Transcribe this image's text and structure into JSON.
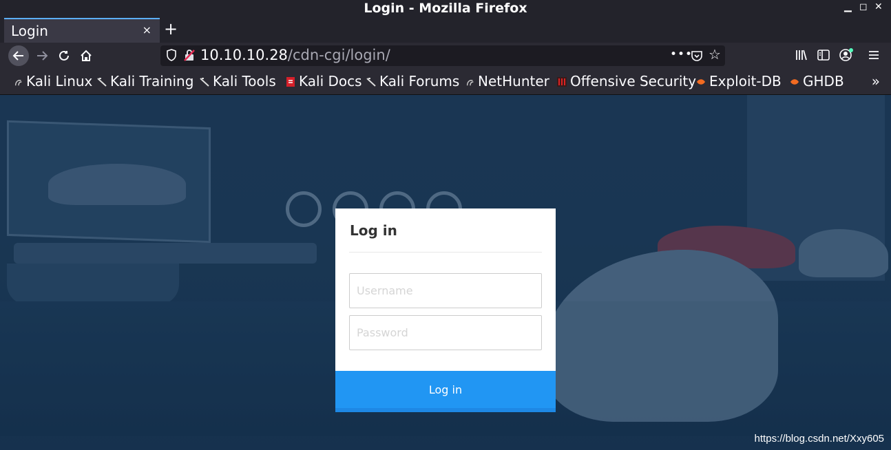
{
  "window": {
    "title": "Login - Mozilla Firefox"
  },
  "tabs": [
    {
      "label": "Login",
      "close": "×"
    }
  ],
  "newtab": "+",
  "nav": {
    "url_host": "10.10.10.28",
    "url_path": "/cdn-cgi/login/",
    "url_more": "•••"
  },
  "bookmarks": [
    {
      "label": "Kali Linux",
      "icon": "kali-dragon-icon"
    },
    {
      "label": "Kali Training",
      "icon": "kali-icon"
    },
    {
      "label": "Kali Tools",
      "icon": "kali-icon"
    },
    {
      "label": "Kali Docs",
      "icon": "docs-icon"
    },
    {
      "label": "Kali Forums",
      "icon": "kali-icon"
    },
    {
      "label": "NetHunter",
      "icon": "kali-dragon-icon"
    },
    {
      "label": "Offensive Security",
      "icon": "offsec-icon"
    },
    {
      "label": "Exploit-DB",
      "icon": "exploitdb-icon"
    },
    {
      "label": "GHDB",
      "icon": "exploitdb-icon"
    }
  ],
  "bookmarks_overflow": "»",
  "login": {
    "heading": "Log in",
    "username_placeholder": "Username",
    "password_placeholder": "Password",
    "submit_label": "Log in"
  },
  "watermark": "https://blog.csdn.net/Xxy605",
  "colors": {
    "accent": "#2196f3",
    "tab_highlight": "#5cb0ff",
    "chrome": "#2b2a33"
  }
}
